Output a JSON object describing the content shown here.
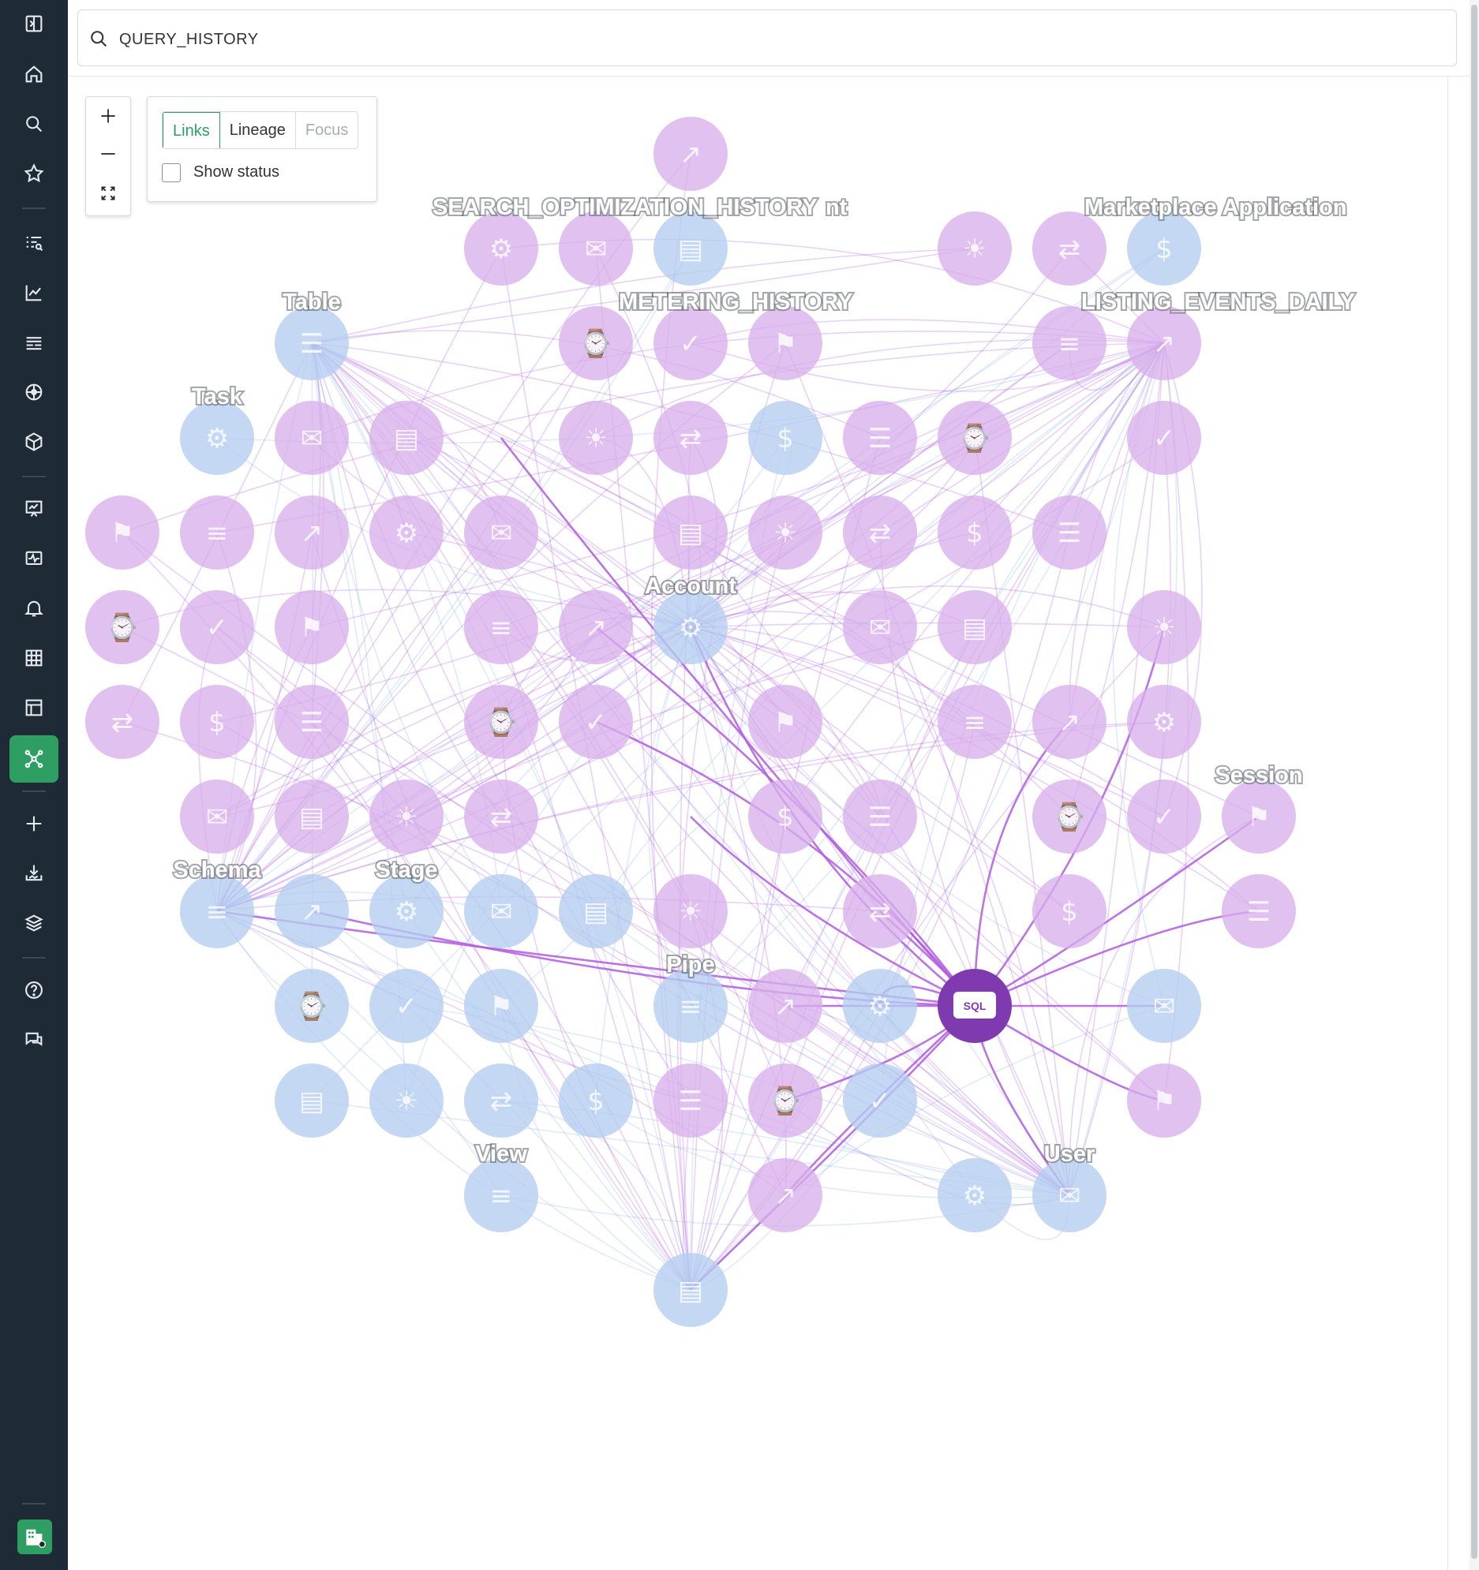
{
  "search": {
    "value": "QUERY_HISTORY"
  },
  "controls": {
    "modes": [
      "Links",
      "Lineage",
      "Focus"
    ],
    "active_mode": "Links",
    "show_status_label": "Show status",
    "show_status_checked": false
  },
  "colors": {
    "sidebar_bg": "#1f2a37",
    "accent_green": "#2e9e63",
    "node_purple": "#d7b0ea",
    "node_blue": "#b4cdf0",
    "center_node": "#7e3aae",
    "edge_purple": "#b05ce0",
    "edge_blue": "#8fb4ea"
  },
  "sidebar": {
    "items": [
      "panel-toggle-icon",
      "home-icon",
      "search-icon",
      "star-icon",
      "list-search-icon",
      "chart-line-icon",
      "stack-lines-icon",
      "hub-icon",
      "cube-icon",
      "presentation-chart-icon",
      "monitor-pulse-icon",
      "bell-icon",
      "grid-icon",
      "table-layout-icon",
      "network-icon",
      "plus-icon",
      "import-icon",
      "layers-icon",
      "help-icon",
      "chat-icon"
    ],
    "active": "network-icon"
  },
  "graph": {
    "center": {
      "label": "SQL"
    },
    "labels": {
      "search_optimization": "SEARCH_OPTIMIZATION_HISTORY",
      "overlap_suffix": "nt",
      "marketplace": "Marketplace Application",
      "metering": "METERING_HISTORY",
      "listing": "LISTING_EVENTS_DAILY",
      "table": "Table",
      "task": "Task",
      "account": "Account",
      "session": "Session",
      "schema": "Schema",
      "stage": "Stage",
      "pipe": "Pipe",
      "view": "View",
      "user": "User"
    }
  }
}
